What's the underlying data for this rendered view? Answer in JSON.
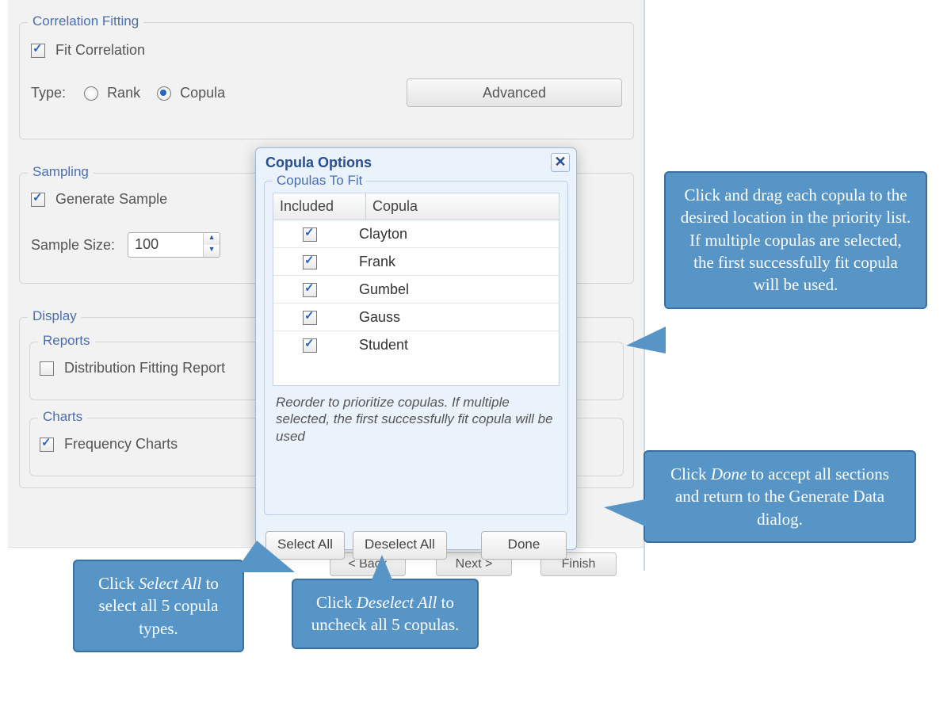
{
  "correlation": {
    "legend": "Correlation Fitting",
    "fit_label": "Fit Correlation",
    "fit_checked": true,
    "type_label": "Type:",
    "rank_label": "Rank",
    "copula_label": "Copula",
    "selected": "copula",
    "advanced_label": "Advanced"
  },
  "sampling": {
    "legend": "Sampling",
    "generate_label": "Generate Sample",
    "generate_checked": true,
    "size_label": "Sample Size:",
    "size_value": "100"
  },
  "display": {
    "legend": "Display",
    "reports_legend": "Reports",
    "report_label": "Distribution Fitting Report",
    "report_checked": false,
    "charts_legend": "Charts",
    "charts_label": "Frequency Charts",
    "charts_checked": true
  },
  "dialog": {
    "title": "Copula Options",
    "group_legend": "Copulas To Fit",
    "col_included": "Included",
    "col_copula": "Copula",
    "rows": [
      {
        "name": "Clayton",
        "checked": true
      },
      {
        "name": "Frank",
        "checked": true
      },
      {
        "name": "Gumbel",
        "checked": true
      },
      {
        "name": "Gauss",
        "checked": true
      },
      {
        "name": "Student",
        "checked": true
      }
    ],
    "hint": "Reorder to prioritize copulas. If multiple selected, the first successfully fit copula will be used",
    "select_all": "Select All",
    "deselect_all": "Deselect All",
    "done": "Done"
  },
  "wizard": {
    "back": "< Back",
    "next": "Next >",
    "finish": "Finish"
  },
  "callouts": {
    "drag_a": "Click and drag each copula to the desired location in the priority list.  If multiple copulas are selected, the first successfully fit copula will be used.",
    "done_a": "Click ",
    "done_b": "Done",
    "done_c": " to accept all sections and return to the Generate Data dialog.",
    "sel_a": "Click ",
    "sel_b": "Select All",
    "sel_c": " to select all 5 copula types.",
    "des_a": "Click ",
    "des_b": "Deselect All",
    "des_c": " to uncheck all 5 copulas."
  }
}
